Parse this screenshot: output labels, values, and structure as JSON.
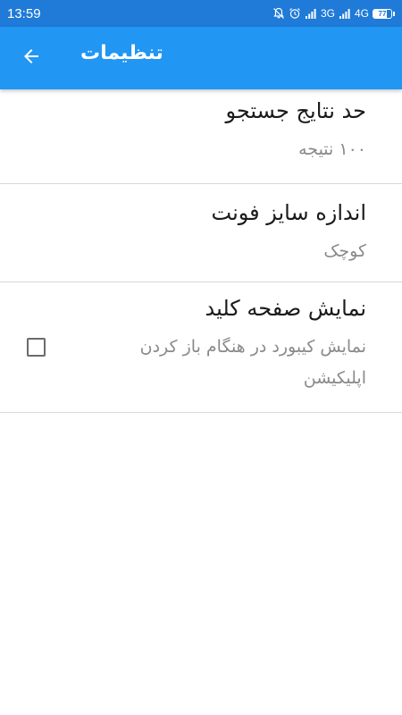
{
  "status_bar": {
    "time": "13:59",
    "network_1": "3G",
    "network_2": "4G",
    "battery_level": "77",
    "battery_fraction": 0.77,
    "icons": [
      "notifications-off-icon",
      "alarm-icon",
      "signal-icon",
      "signal-icon",
      "battery-icon"
    ]
  },
  "app_bar": {
    "title": "تنظیمات",
    "back_icon": "arrow-back-icon",
    "color": "#2196f3"
  },
  "settings": [
    {
      "title": "حد نتایج جستجو",
      "summary": "۱۰۰ نتیجه",
      "type": "list"
    },
    {
      "title": "اندازه سایز فونت",
      "summary": "کوچک",
      "type": "list"
    },
    {
      "title": "نمایش صفحه کلید",
      "summary": "نمایش کیبورد در هنگام باز کردن اپلیکیشن",
      "type": "checkbox",
      "checked": false
    }
  ]
}
